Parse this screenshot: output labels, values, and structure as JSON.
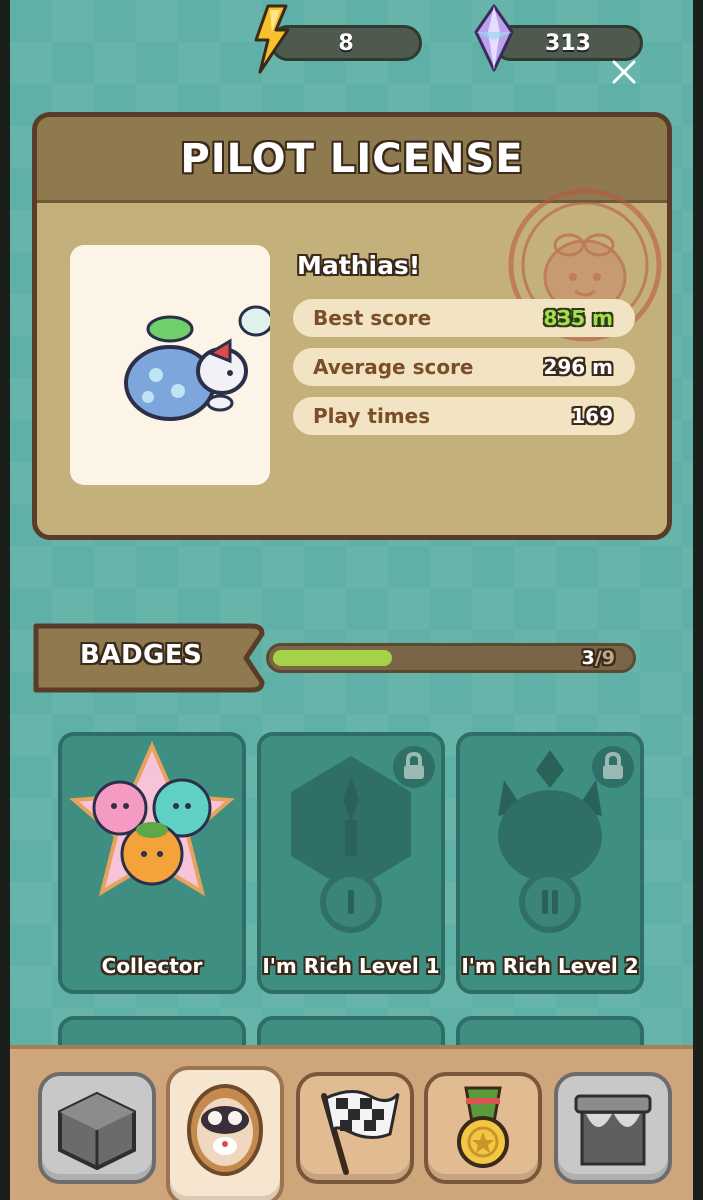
{
  "currency": {
    "energy": "8",
    "gems": "313",
    "energy_icon": "lightning-bolt-icon",
    "gem_icon": "crystal-gem-icon"
  },
  "license": {
    "title": "PILOT LICENSE",
    "player_name": "Mathias!",
    "stats": [
      {
        "label": "Best score",
        "value": "835 m",
        "color": "#a8e04a"
      },
      {
        "label": "Average score",
        "value": "296 m"
      },
      {
        "label": "Play times",
        "value": "169"
      }
    ]
  },
  "badges": {
    "title": "BADGES",
    "progress_current": "3",
    "progress_total": "/9",
    "progress_fraction": 0.333,
    "items": [
      {
        "name": "Collector",
        "locked": false
      },
      {
        "name": "I'm Rich Level 1",
        "locked": true
      },
      {
        "name": "I'm Rich Level 2",
        "locked": true
      }
    ]
  },
  "nav": {
    "items": [
      "shop-box-icon",
      "pilot-avatar-icon",
      "checkered-flag-icon",
      "medal-icon",
      "gate-icon"
    ],
    "active": "pilot-avatar-icon"
  },
  "colors": {
    "background": "#5fb0a6",
    "card": "#c4b07b",
    "card_border": "#5a3b28",
    "accent_green": "#a6d24a"
  }
}
